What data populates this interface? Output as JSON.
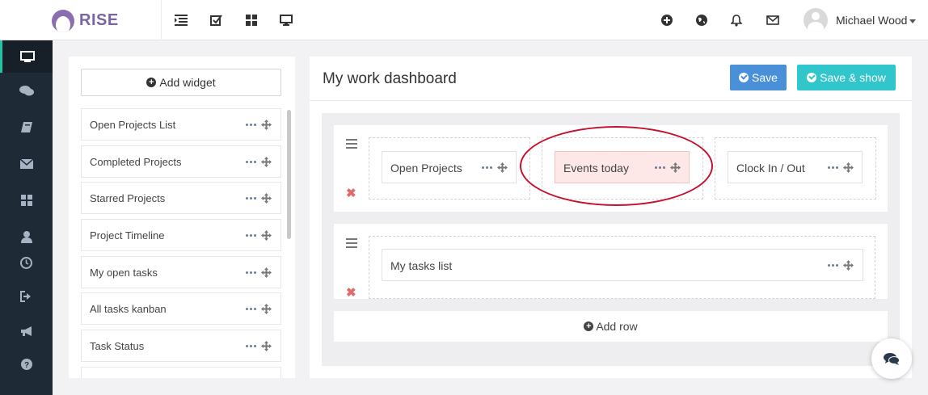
{
  "brand": {
    "name": "RISE"
  },
  "topbar": {
    "left_icons": [
      "list-icon",
      "checkbox-icon",
      "grid-icon",
      "monitor-icon"
    ],
    "right_icons": [
      "plus-circle-icon",
      "globe-icon",
      "bell-icon",
      "envelope-icon"
    ],
    "user_name": "Michael Wood"
  },
  "sidebar": {
    "items": [
      {
        "icon": "monitor-icon",
        "active": true
      },
      {
        "icon": "comments-icon",
        "active": false
      },
      {
        "icon": "book-icon",
        "active": false
      },
      {
        "icon": "envelope-icon",
        "active": false
      },
      {
        "icon": "grid-icon",
        "active": false
      },
      {
        "icon": "user-icon",
        "active": false
      },
      {
        "icon": "clock-icon",
        "active": false
      },
      {
        "icon": "sign-out-icon",
        "active": false
      },
      {
        "icon": "megaphone-icon",
        "active": false
      },
      {
        "icon": "question-icon",
        "active": false
      }
    ]
  },
  "widget_panel": {
    "add_widget_label": "Add widget",
    "items": [
      {
        "label": "Open Projects List"
      },
      {
        "label": "Completed Projects"
      },
      {
        "label": "Starred Projects"
      },
      {
        "label": "Project Timeline"
      },
      {
        "label": "My open tasks"
      },
      {
        "label": "All tasks kanban"
      },
      {
        "label": "Task Status"
      }
    ]
  },
  "dashboard": {
    "title": "My work dashboard",
    "save_label": "Save",
    "save_show_label": "Save & show",
    "rows": [
      {
        "columns": [
          {
            "widget": "Open Projects",
            "highlighted": false
          },
          {
            "widget": "Events today",
            "highlighted": true
          },
          {
            "widget": "Clock In / Out",
            "highlighted": false
          }
        ]
      },
      {
        "columns": [
          {
            "widget": "My tasks list",
            "highlighted": false
          }
        ]
      }
    ],
    "add_row_label": "Add row"
  },
  "colors": {
    "accent": "#4a90d9",
    "teal": "#31c5cc",
    "sidebar_bg": "#1f2a37",
    "highlight_bg": "#fde7e7",
    "annotation": "#c8102e",
    "brand": "#7b64a6"
  }
}
